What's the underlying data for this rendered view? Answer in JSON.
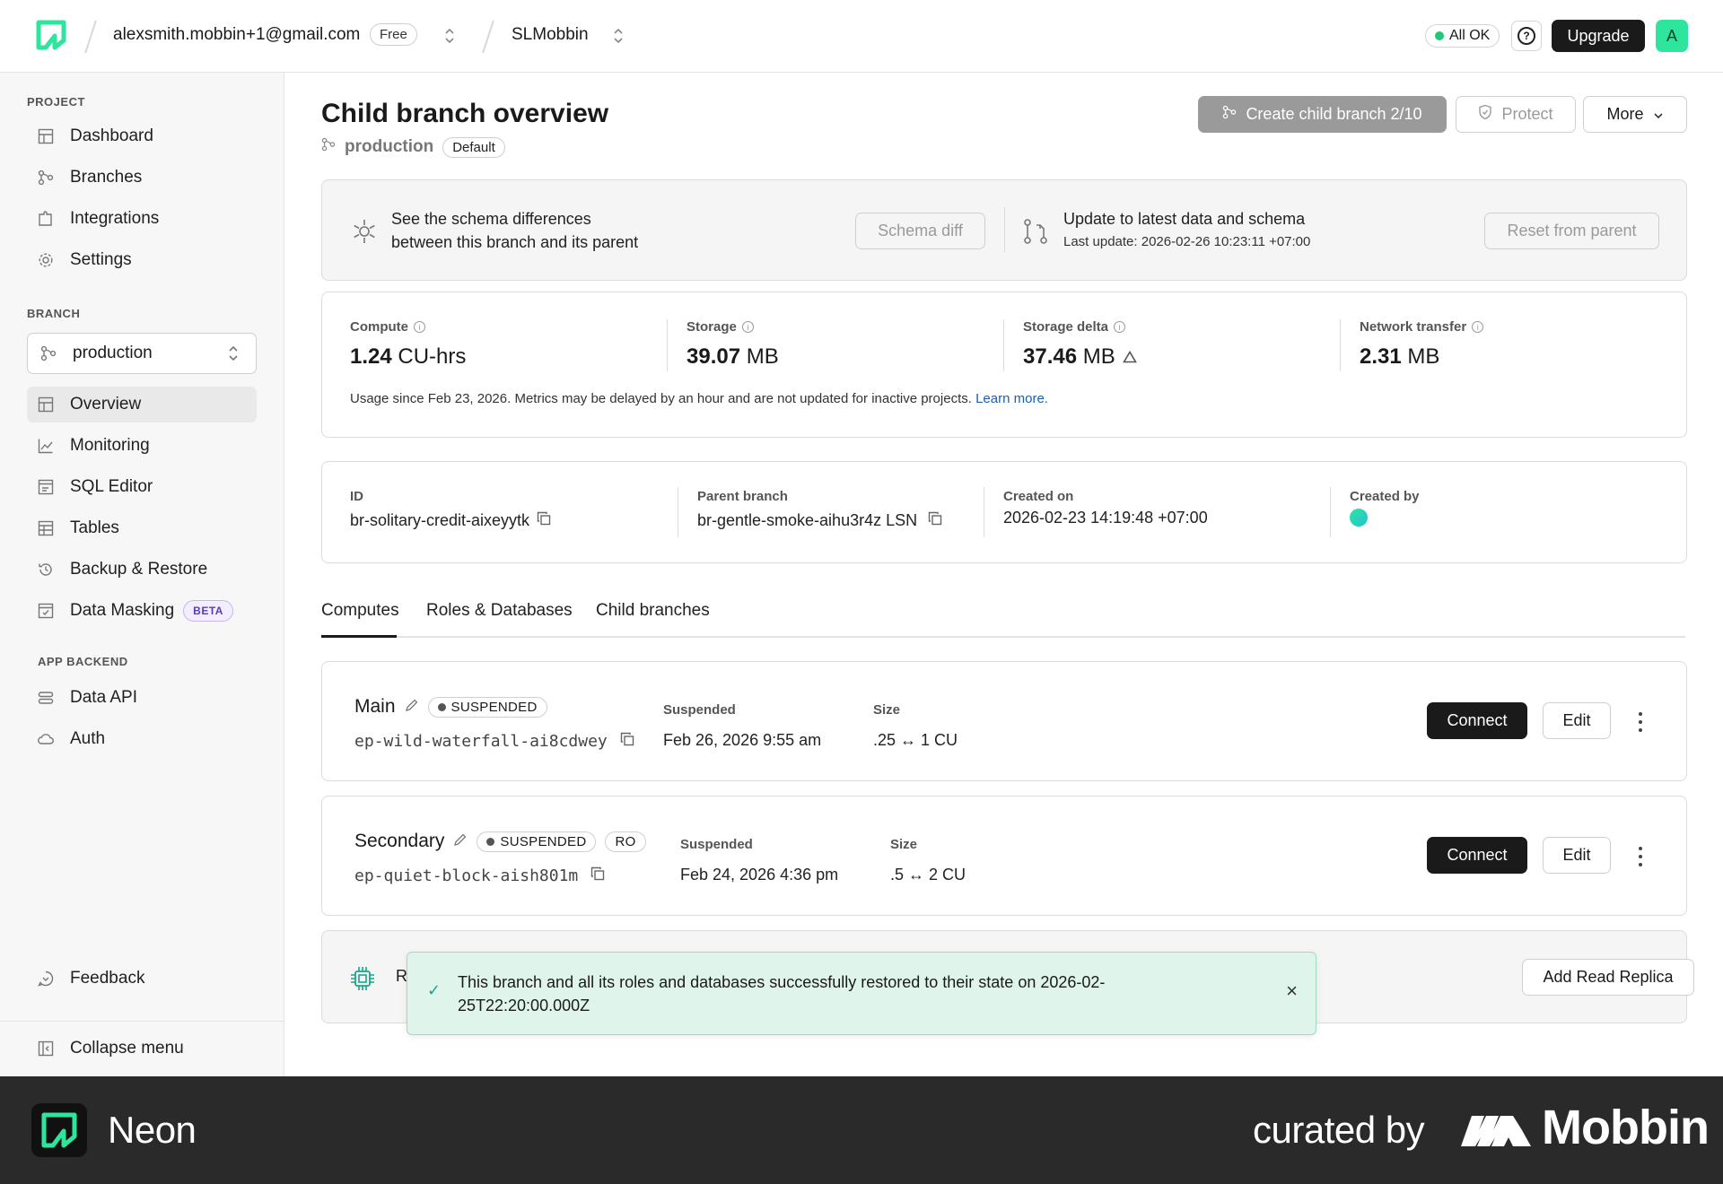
{
  "topbar": {
    "email": "alexsmith.mobbin+1@gmail.com",
    "plan": "Free",
    "project": "SLMobbin",
    "status": "All OK",
    "help": "?",
    "upgrade": "Upgrade",
    "avatar": "A"
  },
  "sidebar": {
    "project_section": "PROJECT",
    "project_items": [
      "Dashboard",
      "Branches",
      "Integrations",
      "Settings"
    ],
    "branch_section": "BRANCH",
    "branch_select": "production",
    "branch_items": [
      "Overview",
      "Monitoring",
      "SQL Editor",
      "Tables",
      "Backup & Restore",
      "Data Masking"
    ],
    "beta": "BETA",
    "app_section": "APP BACKEND",
    "app_items": [
      "Data API",
      "Auth"
    ],
    "feedback": "Feedback",
    "collapse": "Collapse menu"
  },
  "page": {
    "title": "Child branch overview",
    "branch": "production",
    "default_badge": "Default",
    "create_child": "Create child branch 2/10",
    "protect": "Protect",
    "more": "More"
  },
  "schema": {
    "text_1": "See the schema differences",
    "text_2": "between this branch and its parent",
    "schema_diff": "Schema diff",
    "update_title": "Update to latest data and schema",
    "update_sub": "Last update: 2026-02-26 10:23:11 +07:00",
    "reset": "Reset from parent"
  },
  "metrics": {
    "compute_label": "Compute",
    "compute_value": "1.24",
    "compute_unit": "CU-hrs",
    "storage_label": "Storage",
    "storage_value": "39.07",
    "storage_unit": "MB",
    "delta_label": "Storage delta",
    "delta_value": "37.46",
    "delta_unit": "MB",
    "network_label": "Network transfer",
    "network_value": "2.31",
    "network_unit": "MB",
    "note": "Usage since Feb 23, 2026. Metrics may be delayed by an hour and are not updated for inactive projects.",
    "learn_more": "Learn more."
  },
  "details": {
    "id_label": "ID",
    "id_value": "br-solitary-credit-aixeyytk",
    "parent_label": "Parent branch",
    "parent_value": "br-gentle-smoke-aihu3r4z LSN",
    "created_on_label": "Created on",
    "created_on_value": "2026-02-23 14:19:48 +07:00",
    "created_by_label": "Created by"
  },
  "tabs": [
    "Computes",
    "Roles & Databases",
    "Child branches"
  ],
  "computes": [
    {
      "name": "Main",
      "status": "SUSPENDED",
      "endpoint": "ep-wild-waterfall-ai8cdwey",
      "suspended_label": "Suspended",
      "suspended_value": "Feb 26, 2026 9:55 am",
      "size_label": "Size",
      "size_value": ".25 ↔ 1 CU",
      "connect": "Connect",
      "edit": "Edit"
    },
    {
      "name": "Secondary",
      "status": "SUSPENDED",
      "ro": "RO",
      "endpoint": "ep-quiet-block-aish801m",
      "suspended_label": "Suspended",
      "suspended_value": "Feb 24, 2026 4:36 pm",
      "size_label": "Size",
      "size_value": ".5 ↔ 2 CU",
      "connect": "Connect",
      "edit": "Edit"
    }
  ],
  "replica": {
    "partial_text": "R",
    "add": "Add Read Replica"
  },
  "toast": {
    "message": "This branch and all its roles and databases successfully restored to their state on 2026-02-25T22:20:00.000Z",
    "check": "✓",
    "close": "×"
  },
  "footer": {
    "brand": "Neon",
    "curated": "curated by",
    "mobbin": "Mobbin"
  },
  "colors": {
    "accent_green": "#2ee59d",
    "status_green": "#1fc976",
    "toast_bg": "#dff5ec",
    "dark": "#1a1a1a",
    "link_blue": "#1a5fb4"
  }
}
